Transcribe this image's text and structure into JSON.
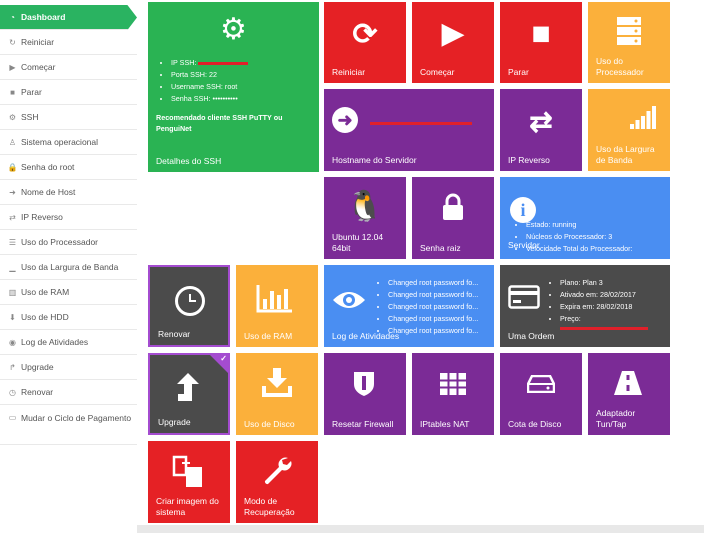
{
  "sidebar": {
    "items": [
      {
        "label": "Dashboard",
        "icon": "dashboard-icon",
        "glyph": "◔"
      },
      {
        "label": "Reiniciar",
        "icon": "refresh-icon",
        "glyph": "↻"
      },
      {
        "label": "Começar",
        "icon": "play-icon",
        "glyph": "▶"
      },
      {
        "label": "Parar",
        "icon": "stop-icon",
        "glyph": "■"
      },
      {
        "label": "SSH",
        "icon": "gear-icon",
        "glyph": "⚙"
      },
      {
        "label": "Sistema operacional",
        "icon": "linux-icon",
        "glyph": "♙"
      },
      {
        "label": "Senha do root",
        "icon": "lock-icon",
        "glyph": "🔒"
      },
      {
        "label": "Nome de Host",
        "icon": "arrow-circle-icon",
        "glyph": "➜"
      },
      {
        "label": "IP Reverso",
        "icon": "retweet-icon",
        "glyph": "⇄"
      },
      {
        "label": "Uso do Processador",
        "icon": "server-icon",
        "glyph": "☰"
      },
      {
        "label": "Uso da Largura de Banda",
        "icon": "signal-icon",
        "glyph": "▁"
      },
      {
        "label": "Uso de RAM",
        "icon": "bar-chart-icon",
        "glyph": "▥"
      },
      {
        "label": "Uso de HDD",
        "icon": "download-icon",
        "glyph": "⬇"
      },
      {
        "label": "Log de Atividades",
        "icon": "eye-icon",
        "glyph": "◉"
      },
      {
        "label": "Upgrade",
        "icon": "upgrade-icon",
        "glyph": "↱"
      },
      {
        "label": "Renovar",
        "icon": "clock-icon",
        "glyph": "◷"
      },
      {
        "label": "Mudar o Ciclo de Pagamento",
        "icon": "card-icon",
        "glyph": "▭"
      }
    ]
  },
  "tiles": {
    "ssh": {
      "label": "Detalhes do SSH",
      "ip": "IP SSH:",
      "port": "Porta SSH: 22",
      "user": "Username SSH: root",
      "pass": "Senha SSH: ••••••••••",
      "recommend": "Recomendado cliente SSH PuTTY ou PenguiNet"
    },
    "restart": {
      "label": "Reiniciar"
    },
    "start": {
      "label": "Começar"
    },
    "stop": {
      "label": "Parar"
    },
    "cpu": {
      "label": "Uso do Processador"
    },
    "hostname": {
      "label": "Hostname do Servidor"
    },
    "reverse_ip": {
      "label": "IP Reverso"
    },
    "bandwidth": {
      "label": "Uso da Largura de Banda"
    },
    "os": {
      "label": "Ubuntu 12.04 64bit"
    },
    "root_pass": {
      "label": "Senha raiz"
    },
    "server": {
      "label": "Servidor",
      "status": "Estado: running",
      "cores": "Núcleos do Processador: 3",
      "freq": "Velocidade Total do Processador:"
    },
    "renew": {
      "label": "Renovar"
    },
    "ram": {
      "label": "Uso de RAM"
    },
    "log": {
      "label": "Log de Atividades",
      "entries": [
        "Changed root password fo...",
        "Changed root password fo...",
        "Changed root password fo...",
        "Changed root password fo...",
        "Changed root password fo..."
      ]
    },
    "order": {
      "label": "Uma Ordem",
      "plan": "Plano: Plan 3",
      "activated": "Ativado em: 28/02/2017",
      "expires": "Expira em: 28/02/2018",
      "price": "Preço:"
    },
    "upgrade": {
      "label": "Upgrade"
    },
    "disk": {
      "label": "Uso de Disco"
    },
    "firewall": {
      "label": "Resetar Firewall"
    },
    "nat": {
      "label": "IPtables NAT"
    },
    "disk_quota": {
      "label": "Cota de Disco"
    },
    "tun": {
      "label": "Adaptador Tun/Tap"
    },
    "image": {
      "label": "Criar imagem do sistema"
    },
    "recovery": {
      "label": "Modo de Recuperação"
    }
  }
}
